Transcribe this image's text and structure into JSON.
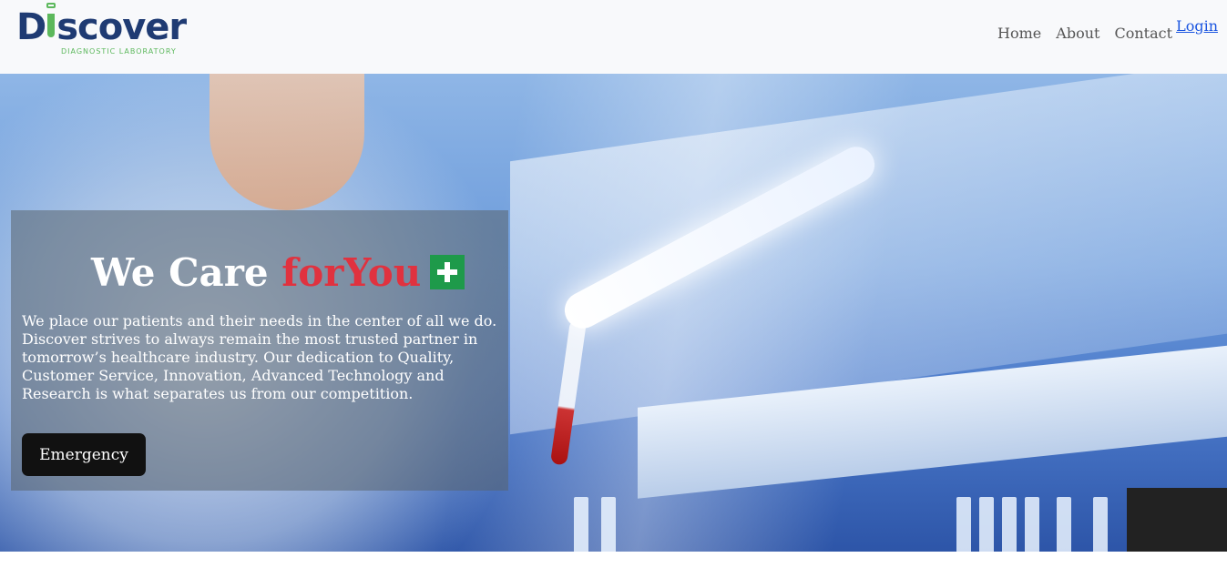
{
  "header": {
    "logo": {
      "word_start": "D",
      "word_end": "scover",
      "tagline": "DIAGNOSTIC LABORATORY"
    },
    "nav": [
      {
        "label": "Home"
      },
      {
        "label": "About"
      },
      {
        "label": "Contact"
      }
    ],
    "login_label": "Login"
  },
  "hero": {
    "headline_white": "We Care ",
    "headline_red": "forYou",
    "description": "We place our patients and their needs in the center of all we do. Discover strives to always remain the most trusted partner in tomorrow’s healthcare industry. Our dedication to Quality, Customer Service, Innovation, Advanced Technology and Research is what separates us from our competition.",
    "button_label": "Emergency"
  },
  "colors": {
    "brand_blue": "#1f3b73",
    "brand_green": "#5cb85c",
    "accent_red": "#e0323f",
    "plus_green": "#1e9a4a",
    "link_blue": "#1a55e0"
  },
  "icons": [
    "test-tube-icon",
    "medical-plus-icon"
  ]
}
